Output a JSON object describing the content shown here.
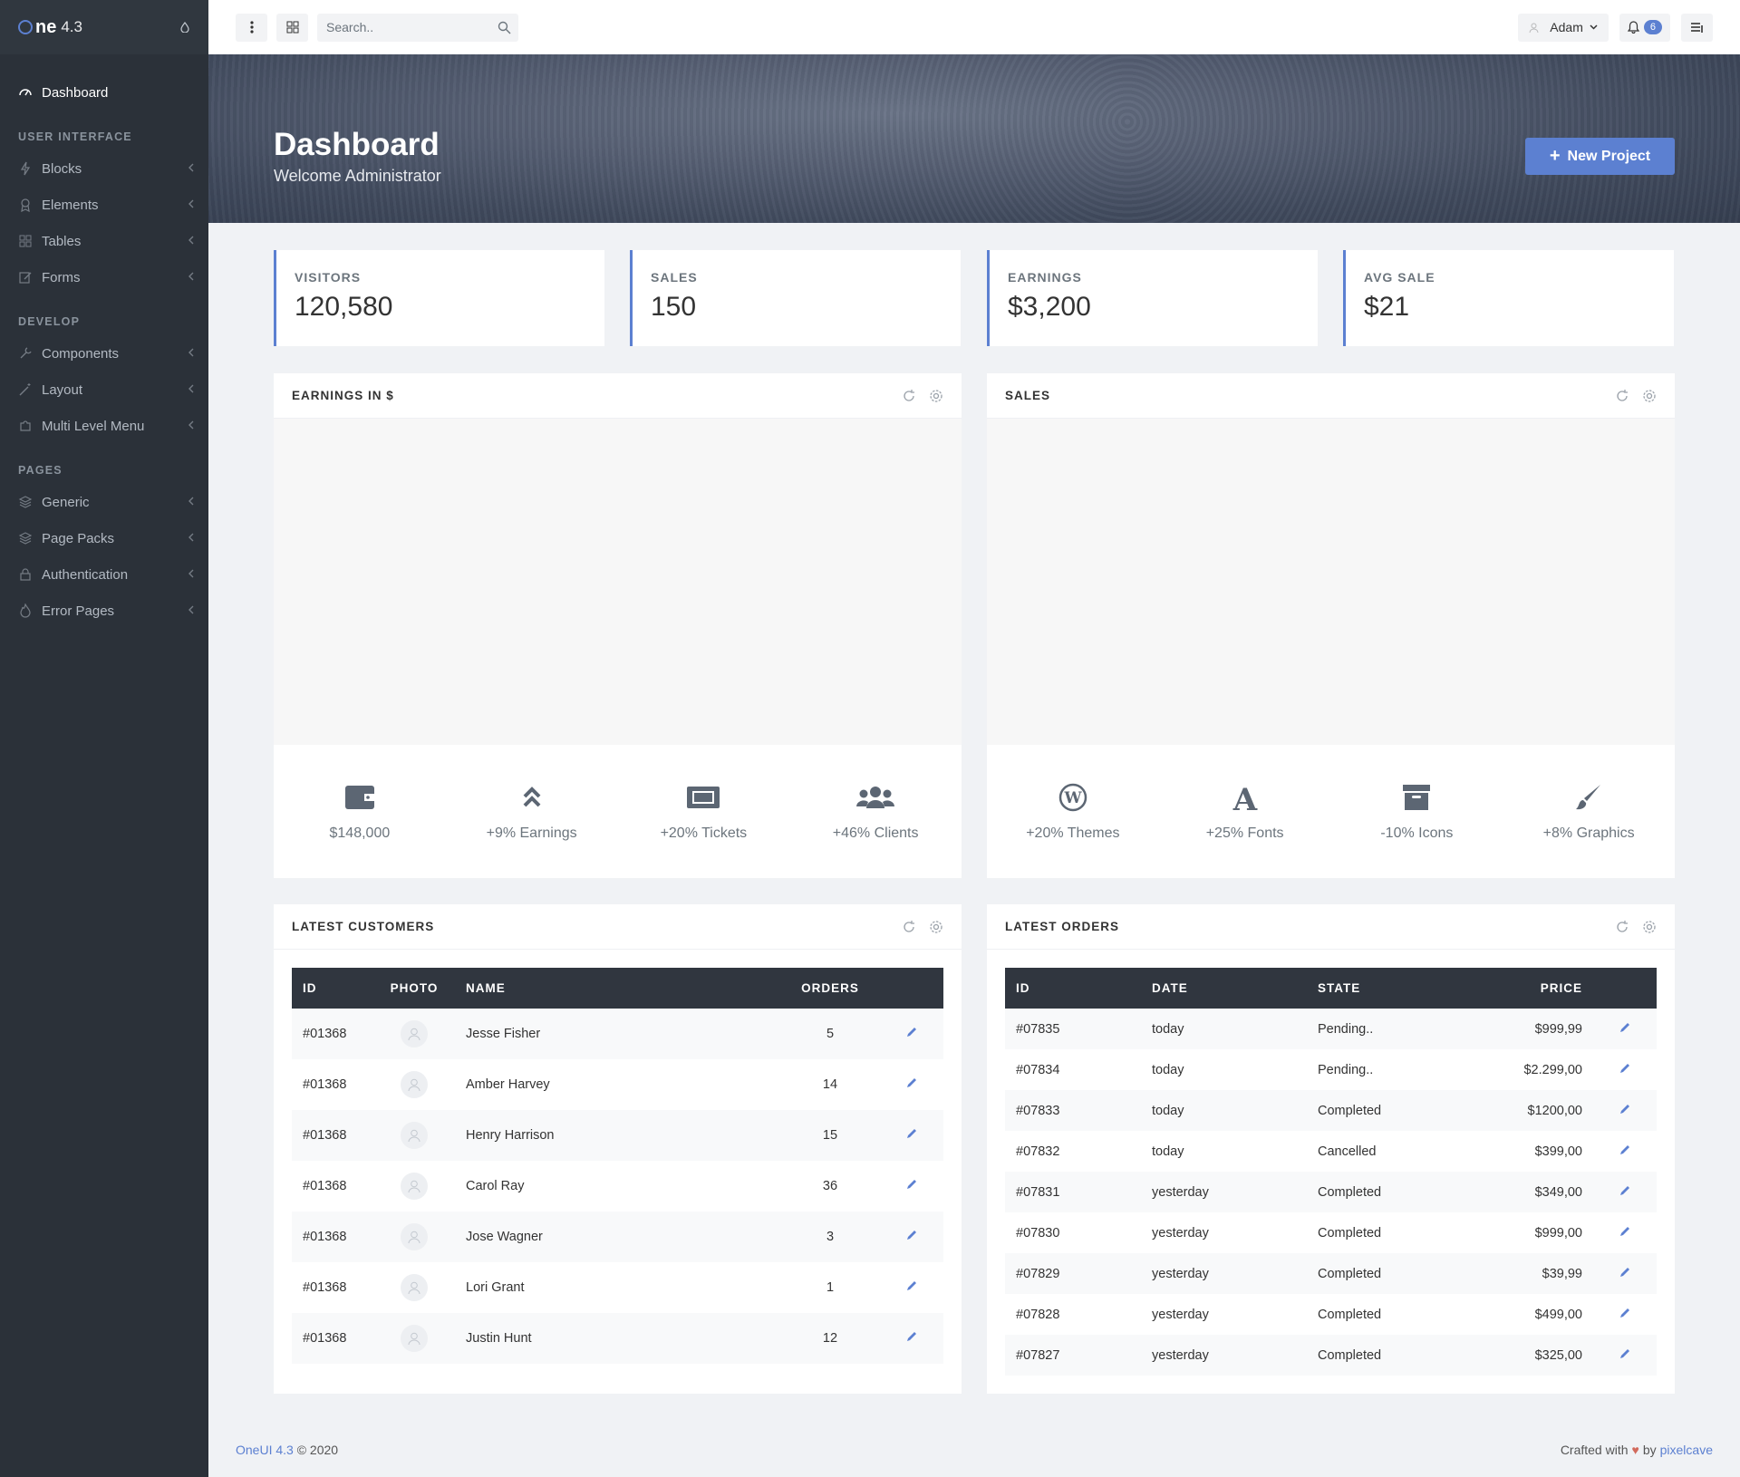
{
  "brand": {
    "logo_main": "ne",
    "version": "4.3"
  },
  "sidebar": {
    "items": [
      {
        "label": "Dashboard"
      },
      {
        "label": "Blocks"
      },
      {
        "label": "Elements"
      },
      {
        "label": "Tables"
      },
      {
        "label": "Forms"
      },
      {
        "label": "Components"
      },
      {
        "label": "Layout"
      },
      {
        "label": "Multi Level Menu"
      },
      {
        "label": "Generic"
      },
      {
        "label": "Page Packs"
      },
      {
        "label": "Authentication"
      },
      {
        "label": "Error Pages"
      }
    ],
    "headings": [
      "User Interface",
      "Develop",
      "Pages"
    ]
  },
  "topbar": {
    "search_placeholder": "Search..",
    "user_name": "Adam",
    "notification_count": "6"
  },
  "hero": {
    "title": "Dashboard",
    "subtitle": "Welcome Administrator",
    "button_label": "New Project"
  },
  "stats": [
    {
      "label": "Visitors",
      "value": "120,580"
    },
    {
      "label": "Sales",
      "value": "150"
    },
    {
      "label": "Earnings",
      "value": "$3,200"
    },
    {
      "label": "Avg Sale",
      "value": "$21"
    }
  ],
  "earnings_block": {
    "title": "Earnings in $",
    "metrics": [
      {
        "icon": "wallet-icon",
        "text": "$148,000"
      },
      {
        "icon": "double-chevron-up-icon",
        "text": "+9% Earnings"
      },
      {
        "icon": "ticket-icon",
        "text": "+20% Tickets"
      },
      {
        "icon": "users-icon",
        "text": "+46% Clients"
      }
    ]
  },
  "sales_block": {
    "title": "Sales",
    "metrics": [
      {
        "icon": "wordpress-icon",
        "text": "+20% Themes"
      },
      {
        "icon": "font-icon",
        "text": "+25% Fonts"
      },
      {
        "icon": "archive-icon",
        "text": "-10% Icons"
      },
      {
        "icon": "paint-brush-icon",
        "text": "+8% Graphics"
      }
    ]
  },
  "customers": {
    "title": "Latest Customers",
    "headers": [
      "ID",
      "Photo",
      "Name",
      "Orders"
    ],
    "rows": [
      {
        "id": "#01368",
        "name": "Jesse Fisher",
        "orders": "5"
      },
      {
        "id": "#01368",
        "name": "Amber Harvey",
        "orders": "14"
      },
      {
        "id": "#01368",
        "name": "Henry Harrison",
        "orders": "15"
      },
      {
        "id": "#01368",
        "name": "Carol Ray",
        "orders": "36"
      },
      {
        "id": "#01368",
        "name": "Jose Wagner",
        "orders": "3"
      },
      {
        "id": "#01368",
        "name": "Lori Grant",
        "orders": "1"
      },
      {
        "id": "#01368",
        "name": "Justin Hunt",
        "orders": "12"
      }
    ]
  },
  "orders": {
    "title": "Latest Orders",
    "headers": [
      "ID",
      "Date",
      "State",
      "Price"
    ],
    "rows": [
      {
        "id": "#07835",
        "date": "today",
        "state": "Pending..",
        "status": "pending",
        "price": "$999,99"
      },
      {
        "id": "#07834",
        "date": "today",
        "state": "Pending..",
        "status": "pending",
        "price": "$2.299,00"
      },
      {
        "id": "#07833",
        "date": "today",
        "state": "Completed",
        "status": "completed",
        "price": "$1200,00"
      },
      {
        "id": "#07832",
        "date": "today",
        "state": "Cancelled",
        "status": "cancelled",
        "price": "$399,00"
      },
      {
        "id": "#07831",
        "date": "yesterday",
        "state": "Completed",
        "status": "completed",
        "price": "$349,00"
      },
      {
        "id": "#07830",
        "date": "yesterday",
        "state": "Completed",
        "status": "completed",
        "price": "$999,00"
      },
      {
        "id": "#07829",
        "date": "yesterday",
        "state": "Completed",
        "status": "completed",
        "price": "$39,99"
      },
      {
        "id": "#07828",
        "date": "yesterday",
        "state": "Completed",
        "status": "completed",
        "price": "$499,00"
      },
      {
        "id": "#07827",
        "date": "yesterday",
        "state": "Completed",
        "status": "completed",
        "price": "$325,00"
      }
    ]
  },
  "footer": {
    "product": "OneUI 4.3",
    "copyright": "© 2020",
    "crafted": "Crafted with",
    "by": "by",
    "author": "pixelcave"
  },
  "colors": {
    "primary": "#5c80d1",
    "sidebar_bg": "#2b3139",
    "pending": "#f3b760",
    "completed": "#46c37b",
    "cancelled": "#d26a5c"
  }
}
